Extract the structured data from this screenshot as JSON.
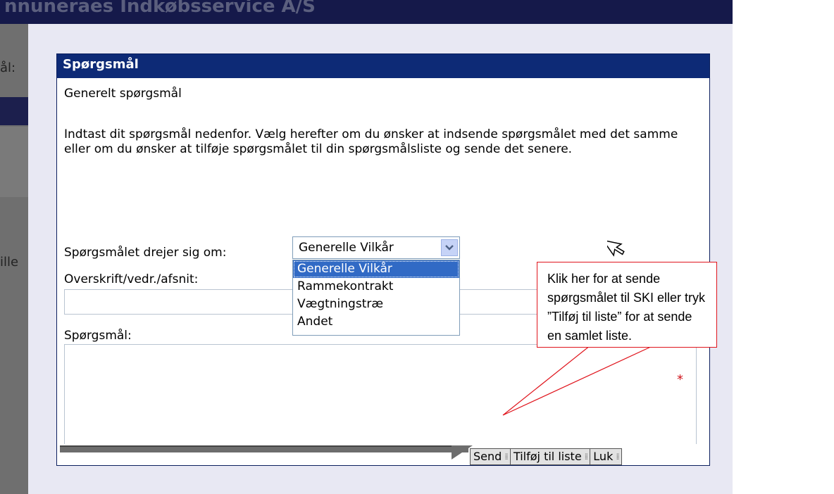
{
  "background": {
    "page_title": "nnuneraes Indkøbsservice A/S",
    "label_1": "ål:",
    "label_2": "ille"
  },
  "dialog": {
    "title": "Spørgsmål",
    "subtitle": "Generelt spørgsmål",
    "intro": "Indtast dit spørgsmål nedenfor. Vælg herefter om du ønsker at indsende spørgsmålet med det samme eller om du ønsker at tilføje spørgsmålet til din spørgsmålsliste og sende det senere.",
    "about_label": "Spørgsmålet drejer sig om:",
    "about_select_value": "Generelle Vilkår",
    "about_options": [
      "Generelle Vilkår",
      "Rammekontrakt",
      "Vægtningstræ",
      "Andet"
    ],
    "heading_label": "Overskrift/vedr./afsnit:",
    "heading_value": "",
    "question_label": "Spørgsmål:",
    "question_value": "",
    "required_marker": "*"
  },
  "footer": {
    "send_label": "Send",
    "add_to_list_label": "Tilføj til liste",
    "close_label": "Luk"
  },
  "callout": {
    "text": "Klik her for at sende spørgsmålet til SKI eller tryk ”Tilføj til liste” for at sende en samlet liste."
  },
  "colors": {
    "header_bg": "#0d2a76",
    "selected_option": "#316ac5",
    "callout_border": "#e0141c"
  }
}
